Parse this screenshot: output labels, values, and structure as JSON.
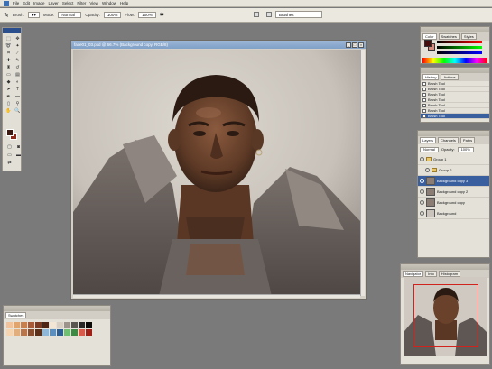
{
  "menubar": {
    "items": [
      "File",
      "Edit",
      "Image",
      "Layer",
      "Select",
      "Filter",
      "View",
      "Window",
      "Help"
    ]
  },
  "optionsbar": {
    "brush_label": "Brush:",
    "mode_label": "Mode:",
    "mode_value": "Normal",
    "opacity_label": "Opacity:",
    "opacity_value": "100%",
    "flow_label": "Flow:",
    "flow_value": "100%",
    "brushes_tab": "Brushes"
  },
  "document": {
    "title": "face01_03.psd @ 66.7% (Background copy, RGB/8)"
  },
  "color_panel": {
    "tabs": [
      "Color",
      "Swatches",
      "Styles"
    ],
    "fg_color": "#4a0d0d",
    "bg_color": "#d98b7d"
  },
  "actions_panel": {
    "tabs": [
      "History",
      "Actions"
    ],
    "items": [
      "Brush Tool",
      "Brush Tool",
      "Brush Tool",
      "Brush Tool",
      "Brush Tool",
      "Brush Tool",
      "Brush Tool",
      "Brush Tool"
    ]
  },
  "layers_panel": {
    "tabs": [
      "Layers",
      "Channels",
      "Paths"
    ],
    "blend_mode": "Normal",
    "opacity_label": "Opacity:",
    "opacity_value": "100%",
    "layers": [
      {
        "name": "Group 1",
        "type": "group"
      },
      {
        "name": "Group 2",
        "type": "group"
      },
      {
        "name": "Background copy 3",
        "type": "layer",
        "selected": true
      },
      {
        "name": "Background copy 2",
        "type": "layer"
      },
      {
        "name": "Background copy",
        "type": "layer"
      },
      {
        "name": "Background",
        "type": "layer"
      }
    ]
  },
  "navigator_panel": {
    "tabs": [
      "Navigator",
      "Info",
      "Histogram"
    ]
  },
  "swatch_panel": {
    "title": "Swatches",
    "colors": [
      "#f2c29a",
      "#e0a46c",
      "#c8804c",
      "#a85a36",
      "#7c3a22",
      "#4e2414",
      "#f4e6d4",
      "#d8cfc2",
      "#9c948a",
      "#5a5650",
      "#2a2826",
      "#0c0b0a",
      "#f6d4b0",
      "#e2ae7c",
      "#b8764a",
      "#8a4e2e",
      "#5c3018",
      "#8fb7d8",
      "#5a8fc0",
      "#2c5e94",
      "#6fbf73",
      "#3c8a44",
      "#d85a4a",
      "#a02018"
    ]
  }
}
